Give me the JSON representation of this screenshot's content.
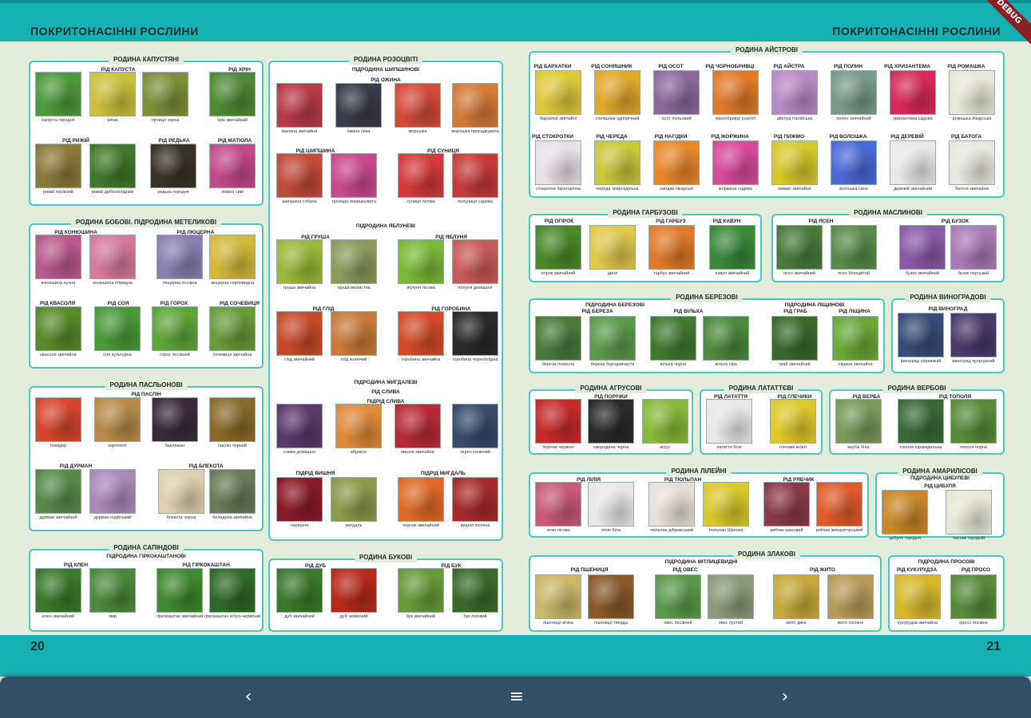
{
  "header": {
    "left_title": "ПОКРИТОНАСІННІ РОСЛИНИ",
    "right_title": "ПОКРИТОНАСІННІ РОСЛИНИ",
    "badge": "DEBUG"
  },
  "footer": {
    "left_page": "20",
    "right_page": "21"
  },
  "navbar": {
    "prev_icon": "chevron-left-icon",
    "menu_icon": "menu-icon",
    "next_icon": "chevron-right-icon",
    "prev_glyph": "‹",
    "menu_glyph": "≡",
    "next_glyph": "›"
  },
  "accent": "#17b1b4",
  "box_border": "#4fc5bf",
  "boxes": [
    {
      "id": "kapustiani",
      "caption": "РОДИНА КАПУСТЯНІ",
      "subs": [],
      "labels": [
        "РІД КАПУСТА",
        "РІД ХРІН",
        "РІД РИЖІЙ",
        "РІД РЕДЬКА",
        "РІД МАТІОЛА"
      ],
      "photos": [
        {
          "name": "капуста городня",
          "color": "#4e9a3c"
        },
        {
          "name": "ріпак",
          "color": "#c9c13a"
        },
        {
          "name": "гірчиця чорна",
          "color": "#7c8f3a"
        },
        {
          "name": "хрін звичайний",
          "color": "#4f8a34"
        },
        {
          "name": "рижій посівний",
          "color": "#8c7a3a"
        },
        {
          "name": "рижій дрібноплідний",
          "color": "#3f7a2a"
        },
        {
          "name": "редька городня",
          "color": "#3b3226"
        },
        {
          "name": "левкої сиві",
          "color": "#c24b8a"
        }
      ]
    },
    {
      "id": "bobovi",
      "caption": "РОДИНА БОБОВІ. ПІДРОДИНА МЕТЕЛИКОВІ",
      "subs": [],
      "labels": [
        "РІД КОНЮШИНА",
        "РІД ЛЮЦЕРНА",
        "РІД КВАСОЛЯ",
        "РІД СОЯ",
        "РІД ГОРОХ",
        "РІД СОЧЕВИЦЯ"
      ],
      "photos": [
        {
          "name": "конюшина лучна",
          "color": "#b95a8c"
        },
        {
          "name": "конюшина гібридна",
          "color": "#d47a9c"
        },
        {
          "name": "люцерна посівна",
          "color": "#8a7fb3"
        },
        {
          "name": "люцерна серповидна",
          "color": "#d4b83a"
        },
        {
          "name": "квасоля звичайна",
          "color": "#5a8a2a"
        },
        {
          "name": "соя культурна",
          "color": "#4a9a3a"
        },
        {
          "name": "горох посівний",
          "color": "#5fa63a"
        },
        {
          "name": "сочевиця звичайна",
          "color": "#6a9a3a"
        }
      ]
    },
    {
      "id": "paslinovi",
      "caption": "РОДИНА ПАСЛЬОНОВІ",
      "subs": [],
      "labels": [
        "РІД ПАСЛІН",
        "РІД ДУРМАН",
        "РІД БЛЕКОТА"
      ],
      "photos": [
        {
          "name": "помідор",
          "color": "#d6462f"
        },
        {
          "name": "картопля",
          "color": "#b88a4a"
        },
        {
          "name": "баклажан",
          "color": "#3a2a3a"
        },
        {
          "name": "паслін чорний",
          "color": "#8a6a2a"
        },
        {
          "name": "дурман звичайний",
          "color": "#5a8a4a"
        },
        {
          "name": "дурман індійський",
          "color": "#a88ab8"
        },
        {
          "name": "блекота чорна",
          "color": "#dcd0b0"
        },
        {
          "name": "беладона звичайна",
          "color": "#6a7a5a"
        }
      ]
    },
    {
      "id": "sapindovi",
      "caption": "РОДИНА САПІНДОВІ",
      "subs": [
        "ПІДРОДИНА ГІРКОКАШТАНОВІ"
      ],
      "labels": [
        "РІД КЛЕН",
        "РІД ГІРКОКАШТАН"
      ],
      "photos": [
        {
          "name": "клен звичайний",
          "color": "#3a7a2a"
        },
        {
          "name": "явір",
          "color": "#4a8a3a"
        },
        {
          "name": "гіркокаштан звичайний",
          "color": "#3f8a30"
        },
        {
          "name": "гіркокаштан м'ясо-червоний",
          "color": "#2f6a28"
        }
      ]
    },
    {
      "id": "rozotsviti",
      "caption": "РОДИНА РОЗОЦВІТІ",
      "subs": [
        "ПІДРОДИНА ШИПШИНОВІ",
        "ПІДРОДИНА ЯБЛУНЕВІ",
        "ПІДРОДИНА МИГДАЛЕВІ"
      ],
      "labels": [
        "РІД ОЖИНА",
        "РІД ШИПШИНА",
        "РІД СУНИЦЯ",
        "РІД ГРУША",
        "РІД ЯБЛУНЯ",
        "РІД ГЛІД",
        "РІД ГОРОБИНА",
        "РІД СЛИВА",
        "ПІДРІД СЛИВА",
        "ПІДРІД ВИШНЯ",
        "ПІДРІД МИГДАЛЬ"
      ],
      "photos": [
        {
          "name": "малина звичайна",
          "color": "#b83a4a"
        },
        {
          "name": "ожина сиза",
          "color": "#3a3a4a"
        },
        {
          "name": "морошка",
          "color": "#d44a3a"
        },
        {
          "name": "морошка присадкувата",
          "color": "#d47a3a"
        },
        {
          "name": "шипшина собача",
          "color": "#c24a3a"
        },
        {
          "name": "троянда зморшкувата",
          "color": "#c84a8a"
        },
        {
          "name": "суниця лісова",
          "color": "#d43a3a"
        },
        {
          "name": "полуниця садова",
          "color": "#c83a3a"
        },
        {
          "name": "груша звичайна",
          "color": "#9ab83a"
        },
        {
          "name": "груша іволистна",
          "color": "#8a9a5a"
        },
        {
          "name": "яблуня лісова",
          "color": "#7ab83a"
        },
        {
          "name": "яблуня домашня",
          "color": "#c85a5a"
        },
        {
          "name": "глід звичайний",
          "color": "#c84a2a"
        },
        {
          "name": "глід колючий",
          "color": "#c87a3a"
        },
        {
          "name": "горобина звичайна",
          "color": "#d44a2a"
        },
        {
          "name": "горобина чорноплідна",
          "color": "#2a2a2a"
        },
        {
          "name": "слива домашня",
          "color": "#5a3a6a"
        },
        {
          "name": "абрикос",
          "color": "#e08a3a"
        },
        {
          "name": "вишня звичайна",
          "color": "#b82a3a"
        },
        {
          "name": "терен колючий",
          "color": "#3a4a6a"
        },
        {
          "name": "черешня",
          "color": "#8a1a2a"
        },
        {
          "name": "мигдаль",
          "color": "#8a9a4a"
        },
        {
          "name": "персик звичайний",
          "color": "#e06a2a"
        },
        {
          "name": "вишня пісочна",
          "color": "#a82a2a"
        }
      ]
    },
    {
      "id": "bukovi",
      "caption": "РОДИНА БУКОВІ",
      "subs": [],
      "labels": [
        "РІД ДУБ",
        "РІД БУК"
      ],
      "photos": [
        {
          "name": "дуб звичайний",
          "color": "#3a7a2a"
        },
        {
          "name": "дуб червоний",
          "color": "#b82a1a"
        },
        {
          "name": "бук звичайний",
          "color": "#6a9a3a"
        },
        {
          "name": "бук лісовий",
          "color": "#3a6a2a"
        }
      ]
    },
    {
      "id": "aistrovi",
      "caption": "РОДИНА АЙСТРОВІ",
      "subs": [],
      "labels": [
        "РІД БАРХАТКИ",
        "РІД СОНЯШНИК",
        "РІД ОСОТ",
        "РІД ЧОРНОБРИВЦІ",
        "РІД АЙСТРА",
        "РІД ПОЛИН",
        "РІД ХРИЗАНТЕМА",
        "РІД РОМАШКА",
        "РІД СТОКРОТКИ",
        "РІД ЧЕРЕДА",
        "РІД НАГІДКИ",
        "РІД ЖОРЖИНА",
        "РІД ПИЖМО",
        "РІД ВОЛОШКА",
        "РІД ДЕРЕВІЙ",
        "РІД БАТОГА"
      ],
      "photos": [
        {
          "name": "бархатки звичайні",
          "color": "#e0c83a"
        },
        {
          "name": "соняшник однорічний",
          "color": "#e0a82a"
        },
        {
          "name": "осот польовий",
          "color": "#8a6a9a"
        },
        {
          "name": "чорнобривці розлогі",
          "color": "#e07a2a"
        },
        {
          "name": "айстра італійська",
          "color": "#b88ac8"
        },
        {
          "name": "полин звичайний",
          "color": "#7a9a8a"
        },
        {
          "name": "хризантема садова",
          "color": "#d82a5a"
        },
        {
          "name": "ромашка лікарська",
          "color": "#e8e8d8"
        },
        {
          "name": "стокротка багаторічна",
          "color": "#e8e0e8"
        },
        {
          "name": "череда трироздільна",
          "color": "#c8c83a"
        },
        {
          "name": "нагідки лікарські",
          "color": "#e8882a"
        },
        {
          "name": "жоржина садова",
          "color": "#d84a9a"
        },
        {
          "name": "пижмо звичайне",
          "color": "#d8c82a"
        },
        {
          "name": "волошка синя",
          "color": "#4a6ad8"
        },
        {
          "name": "деревій звичайний",
          "color": "#e8e8e8"
        },
        {
          "name": "батога звичайна",
          "color": "#e8e8e0"
        }
      ]
    },
    {
      "id": "garbuzovi",
      "caption": "РОДИНА ГАРБУЗОВІ",
      "subs": [],
      "labels": [
        "РІД ОГІРОК",
        "РІД ГАРБУЗ",
        "РІД КАВУН"
      ],
      "photos": [
        {
          "name": "огірок звичайний",
          "color": "#4a8a2a"
        },
        {
          "name": "диня",
          "color": "#e0c84a"
        },
        {
          "name": "гарбуз звичайний",
          "color": "#e07a2a"
        },
        {
          "name": "кавун звичайний",
          "color": "#3a8a3a"
        }
      ]
    },
    {
      "id": "maslynovi",
      "caption": "РОДИНА МАСЛИНОВІ",
      "subs": [],
      "labels": [
        "РІД ЯСЕН",
        "РІД БУЗОК"
      ],
      "photos": [
        {
          "name": "ясен звичайний",
          "color": "#4a7a3a"
        },
        {
          "name": "ясен білоцвітий",
          "color": "#5a8a4a"
        },
        {
          "name": "бузок звичайний",
          "color": "#8a5aa8"
        },
        {
          "name": "бузок перський",
          "color": "#a87ab8"
        }
      ]
    },
    {
      "id": "berezovi",
      "caption": "РОДИНА БЕРЕЗОВІ",
      "subs": [
        "ПІДРОДИНА БЕРЕЗОВІ",
        "ПІДРОДИНА ЛІЩИНОВІ"
      ],
      "labels": [
        "РІД БЕРЕЗА",
        "РІД ВІЛЬХА",
        "РІД ГРАБ",
        "РІД ЛІЩИНА"
      ],
      "photos": [
        {
          "name": "береза повисла",
          "color": "#4a7a3a"
        },
        {
          "name": "береза бородавчаста",
          "color": "#5a9a4a"
        },
        {
          "name": "вільха чорна",
          "color": "#3f7a30"
        },
        {
          "name": "вільха сіра",
          "color": "#4a8a3a"
        },
        {
          "name": "граб звичайний",
          "color": "#3a6a2a"
        },
        {
          "name": "ліщина звичайна",
          "color": "#6aa83a"
        }
      ]
    },
    {
      "id": "vynogradovi",
      "caption": "РОДИНА ВИНОГРАДОВІ",
      "subs": [],
      "labels": [
        "РІД ВИНОГРАД"
      ],
      "photos": [
        {
          "name": "виноград справжній",
          "color": "#3a4a7a"
        },
        {
          "name": "виноград культурний",
          "color": "#4a3a6a"
        }
      ]
    },
    {
      "id": "agrusovi",
      "caption": "РОДИНА АГРУСОВІ",
      "subs": [],
      "labels": [
        "РІД ПОРІЧКИ"
      ],
      "photos": [
        {
          "name": "порічки червоні",
          "color": "#c82a2a"
        },
        {
          "name": "смородина чорна",
          "color": "#2a2a2a"
        },
        {
          "name": "агрус",
          "color": "#8ab83a"
        }
      ]
    },
    {
      "id": "latattevi",
      "caption": "РОДИНА ЛАТАТТЄВІ",
      "subs": [],
      "labels": [
        "РІД ЛАТАТТЯ",
        "РІД ГЛЕЧИКИ"
      ],
      "photos": [
        {
          "name": "латаття біле",
          "color": "#e8e8e8"
        },
        {
          "name": "глечики жовті",
          "color": "#e0c82a"
        }
      ]
    },
    {
      "id": "verbovi",
      "caption": "РОДИНА ВЕРБОВІ",
      "subs": [],
      "labels": [
        "РІД ВЕРБА",
        "РІД ТОПОЛЯ"
      ],
      "photos": [
        {
          "name": "верба біла",
          "color": "#7a9a5a"
        },
        {
          "name": "тополя пірамідальна",
          "color": "#3a6a3a"
        },
        {
          "name": "тополя чорна",
          "color": "#5a8a3a"
        }
      ]
    },
    {
      "id": "lileini",
      "caption": "РОДИНА ЛІЛЕЙНІ",
      "subs": [],
      "labels": [
        "РІД ЛІЛІЯ",
        "РІД ТЮЛЬПАН",
        "РІД РЯБЧИК"
      ],
      "photos": [
        {
          "name": "лілія лісова",
          "color": "#c85a7a"
        },
        {
          "name": "лілія біла",
          "color": "#e8e8e8"
        },
        {
          "name": "тюльпан дібровський",
          "color": "#e8e0d8"
        },
        {
          "name": "тюльпан Шренка",
          "color": "#d8c82a"
        },
        {
          "name": "рябчик шаховий",
          "color": "#8a3a4a"
        },
        {
          "name": "рябчик імператорський",
          "color": "#e05a2a"
        }
      ]
    },
    {
      "id": "amarylisovi",
      "caption": "РОДИНА АМАРИЛІСОВІ",
      "subs": [
        "ПІДРОДИНА ЦИБУЛЕВІ"
      ],
      "labels": [
        "РІД ЦИБУЛЯ"
      ],
      "photos": [
        {
          "name": "цибуля городня",
          "color": "#c8882a"
        },
        {
          "name": "часник городній",
          "color": "#e8e8d8"
        }
      ]
    },
    {
      "id": "zlakovi",
      "caption": "РОДИНА ЗЛАКОВІ",
      "subs": [
        "ПІДРОДИНА МІТЛИЦЕВИДНІ"
      ],
      "labels": [
        "РІД ПШЕНИЦЯ",
        "РІД ОВЕС",
        "РІД ЖИТО"
      ],
      "photos": [
        {
          "name": "пшениця м'яка",
          "color": "#c8b86a"
        },
        {
          "name": "пшениця тверда",
          "color": "#8a5a2a"
        },
        {
          "name": "овес посівний",
          "color": "#5a9a4a"
        },
        {
          "name": "овес пустий",
          "color": "#8a9a7a"
        },
        {
          "name": "жито дике",
          "color": "#c8a83a"
        },
        {
          "name": "жито посівне",
          "color": "#b89a5a"
        }
      ]
    },
    {
      "id": "prosovi",
      "caption": "",
      "subs": [
        "ПІДРОДИНА ПРОСОВІ"
      ],
      "labels": [
        "РІД КУКУРУДЗА",
        "РІД ПРОСО"
      ],
      "photos": [
        {
          "name": "кукурудза звичайна",
          "color": "#d8b82a"
        },
        {
          "name": "просо посівне",
          "color": "#5a8a3a"
        }
      ]
    }
  ]
}
